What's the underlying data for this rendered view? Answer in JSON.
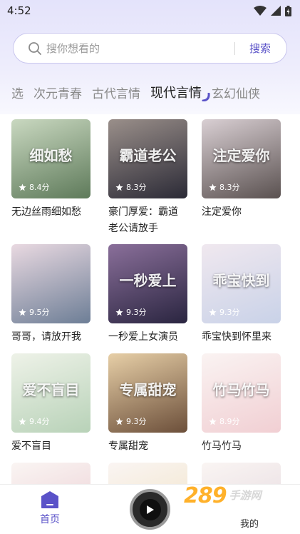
{
  "status_bar": {
    "time": "4:52"
  },
  "search": {
    "placeholder": "搜你想看的",
    "button_label": "搜索"
  },
  "tabs": [
    {
      "label": "选"
    },
    {
      "label": "次元青春"
    },
    {
      "label": "古代言情"
    },
    {
      "label": "现代言情",
      "active": true
    },
    {
      "label": "玄幻仙侠"
    }
  ],
  "books": [
    {
      "title": "无边丝雨细如愁",
      "rating": "8.4分",
      "cover_text": "细如愁",
      "color_a": "#5e7a5a",
      "color_b": "#c9d8c0"
    },
    {
      "title": "豪门厚爱：霸道老公请放手",
      "rating": "8.3分",
      "cover_text": "霸道老公",
      "color_a": "#2b2a36",
      "color_b": "#9a8f8a"
    },
    {
      "title": "注定爱你",
      "rating": "8.3分",
      "cover_text": "注定爱你",
      "color_a": "#5a5150",
      "color_b": "#d9cfd3"
    },
    {
      "title": "哥哥，请放开我",
      "rating": "9.5分",
      "cover_text": "",
      "color_a": "#6d7e96",
      "color_b": "#e9d9e1"
    },
    {
      "title": "一秒爱上女演员",
      "rating": "9.3分",
      "cover_text": "一秒爱上",
      "color_a": "#2a2540",
      "color_b": "#8a6f9a"
    },
    {
      "title": "乖宝快到怀里来",
      "rating": "9.3分",
      "cover_text": "乖宝快到",
      "color_a": "#c9d2e8",
      "color_b": "#f0e8ef"
    },
    {
      "title": "爱不盲目",
      "rating": "9.4分",
      "cover_text": "爱不盲目",
      "color_a": "#b8d2b8",
      "color_b": "#eef2e8"
    },
    {
      "title": "专属甜宠",
      "rating": "9.3分",
      "cover_text": "专属甜宠",
      "color_a": "#6c4f3a",
      "color_b": "#e7cfa7"
    },
    {
      "title": "竹马竹马",
      "rating": "8.9分",
      "cover_text": "竹马竹马",
      "color_a": "#f1cfd3",
      "color_b": "#faf3f2"
    }
  ],
  "bottom_nav": {
    "home_label": "首页",
    "mine_label": "我的"
  },
  "watermark": {
    "number": "289",
    "text": "手游网"
  },
  "colors": {
    "accent": "#5a52c8",
    "star": "#ffffff"
  }
}
